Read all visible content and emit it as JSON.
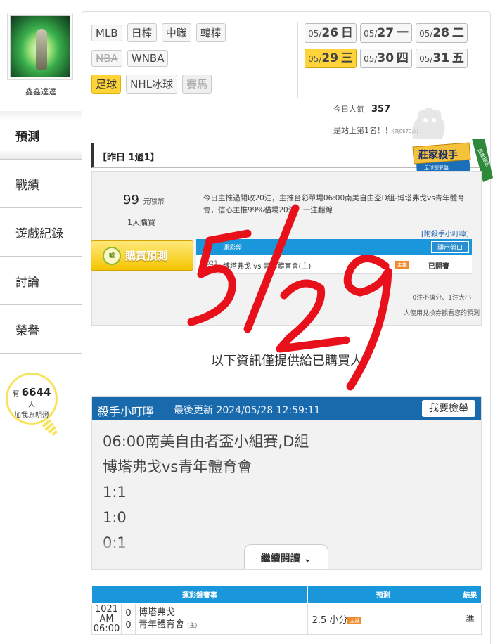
{
  "sidebar": {
    "username": "鑫鑫達達",
    "nav": [
      {
        "label": "預測",
        "active": true
      },
      {
        "label": "戰績",
        "active": false
      },
      {
        "label": "遊戲紀錄",
        "active": false
      },
      {
        "label": "討論",
        "active": false
      },
      {
        "label": "榮譽",
        "active": false
      }
    ],
    "fans": {
      "prefix": "有",
      "count": "6644",
      "suffix": "人",
      "caption": "加我為明燈"
    }
  },
  "sports": [
    {
      "label": "MLB",
      "state": "normal"
    },
    {
      "label": "日棒",
      "state": "normal"
    },
    {
      "label": "中職",
      "state": "normal"
    },
    {
      "label": "韓棒",
      "state": "normal"
    },
    {
      "label": "NBA",
      "state": "disabled"
    },
    {
      "label": "WNBA",
      "state": "normal"
    },
    {
      "label": "足球",
      "state": "active"
    },
    {
      "label": "NHL冰球",
      "state": "normal"
    },
    {
      "label": "賽馬",
      "state": "greyed"
    }
  ],
  "dates": [
    {
      "month": "05/",
      "day": "26",
      "weekday": "日",
      "active": false
    },
    {
      "month": "05/",
      "day": "27",
      "weekday": "一",
      "active": false
    },
    {
      "month": "05/",
      "day": "28",
      "weekday": "二",
      "active": false
    },
    {
      "month": "05/",
      "day": "29",
      "weekday": "三",
      "active": true
    },
    {
      "month": "05/",
      "day": "30",
      "weekday": "四",
      "active": false
    },
    {
      "month": "05/",
      "day": "31",
      "weekday": "五",
      "active": false
    }
  ],
  "popularity": {
    "label": "今日人氣",
    "value": "357",
    "rank_text": "是站上第1名！！",
    "rank_note": "(共8673人)"
  },
  "record": {
    "text": "【昨日 1過1】"
  },
  "badge": {
    "main": "莊家殺手",
    "sub": "足球運彩盤",
    "ribbon": "長期穩定"
  },
  "prediction": {
    "price": "99",
    "price_unit": "元噱幣",
    "buyers": "1人購買",
    "buy_label": "購買預測",
    "buy_icon": "噓",
    "summary": "今日主推過關收20注，主推台彩單場06:00南美自由盃D組-博塔弗戈vs青年體育會，信心主推99%貓場20注，一注翻線",
    "killer_link": "[附殺手小叮嚀]",
    "table": {
      "header": "運彩盤",
      "show_button": "顯示盤口",
      "row": {
        "id": "1021",
        "game": "博塔弗戈 vs 青年體育會(主)",
        "tag": "主推",
        "state": "已開賽"
      }
    },
    "rule_note": "0注不讓分、1注大小",
    "coupon_note": "人使用兌換券觀看您的預測"
  },
  "purchased_msg": "以下資訊僅提供給已購買人",
  "tips": {
    "title": "殺手小叮嚀",
    "updated": "最後更新 2024/05/28 12:59:11",
    "report_button": "我要檢舉",
    "lines": [
      "06:00南美自由者盃小組賽,D組",
      "博塔弗戈vs青年體育會",
      "1:1",
      "1:0",
      "0:1"
    ],
    "more_button": "繼續閱讀"
  },
  "picks": {
    "headers": [
      "運彩盤賽事",
      "預測",
      "結果"
    ],
    "rows": [
      {
        "id": "1021",
        "time": "AM 06:00",
        "score_home": "0",
        "score_away": "0",
        "team1": "博塔弗戈",
        "team2": "青年體育會",
        "home_mark": "(主)",
        "pred": "2.5 小分",
        "tag": "主推",
        "result": "準"
      }
    ]
  },
  "handwriting": {
    "text": "5/29",
    "color": "#e8101a"
  },
  "colors": {
    "accent_blue": "#1a97db",
    "header_blue": "#1969ad",
    "active_yellow": "#ffd43a"
  }
}
